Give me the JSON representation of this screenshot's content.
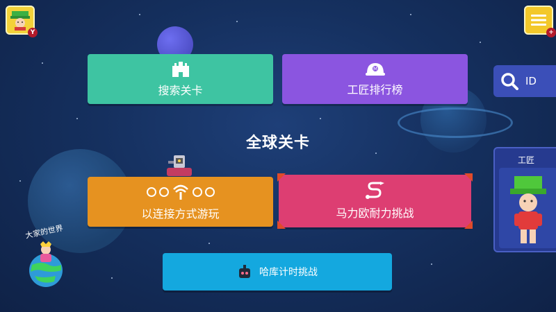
{
  "header": {
    "avatar_badge": "Y"
  },
  "cards": {
    "search": {
      "label": "搜索关卡",
      "icon": "castle-icon"
    },
    "ranking": {
      "label": "工匠排行榜",
      "icon": "helmet-icon"
    },
    "connect": {
      "label": "以连接方式游玩",
      "icon": "wifi-icon"
    },
    "endless": {
      "label": "马力欧耐力挑战",
      "icon": "path-icon"
    },
    "hako": {
      "label": "哈库计时挑战",
      "icon": "robot-icon"
    }
  },
  "heading": "全球关卡",
  "id_search": {
    "label": "ID"
  },
  "maker": {
    "title": "工匠"
  },
  "world": {
    "title": "大家的世界"
  },
  "colors": {
    "background": "#15305f",
    "search": "#3ec4a2",
    "ranking": "#8b55e0",
    "connect": "#e69220",
    "endless": "#dd3e72",
    "hako": "#14a8df",
    "id_button": "#3b4fb8"
  }
}
